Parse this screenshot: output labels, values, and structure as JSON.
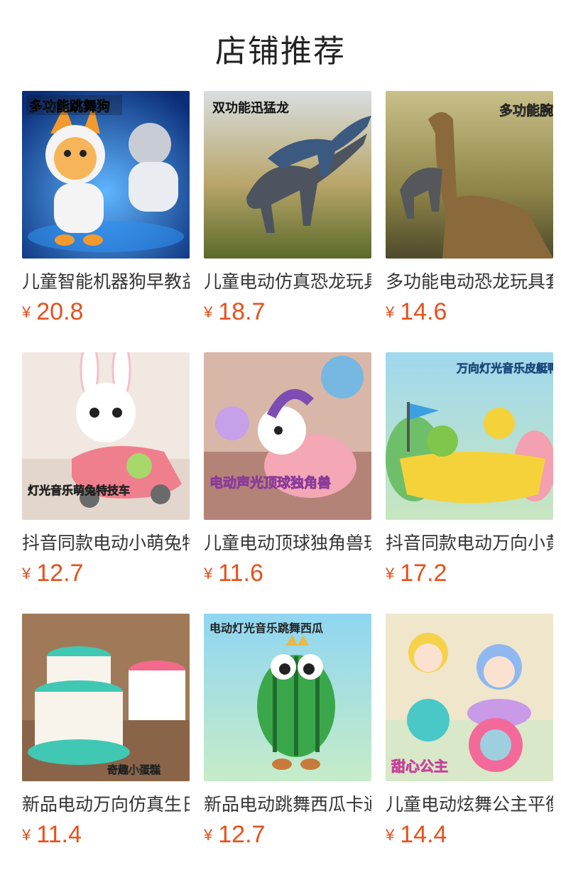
{
  "section_title": "店铺推荐",
  "currency_symbol": "¥",
  "colors": {
    "price": "#e8501c",
    "title": "#222222"
  },
  "products": [
    {
      "name": "儿童智能机器狗早教益智",
      "price": "20.8",
      "overlay": "多功能跳舞狗",
      "bg": "#1e4fa8"
    },
    {
      "name": "儿童电动仿真恐龙玩具",
      "price": "18.7",
      "overlay": "双功能迅猛龙",
      "bg": "#7a8a4a"
    },
    {
      "name": "多功能电动恐龙玩具套装",
      "price": "14.6",
      "overlay": "多功能腕龙",
      "bg": "#8f8a55"
    },
    {
      "name": "抖音同款电动小萌兔特技车",
      "price": "12.7",
      "overlay": "灯光音乐萌兔特技车",
      "bg": "#f4ece6"
    },
    {
      "name": "儿童电动顶球独角兽玩具",
      "price": "11.6",
      "overlay": "电动声光顶球独角兽",
      "bg": "#c9a39a"
    },
    {
      "name": "抖音同款电动万向小黄鸭",
      "price": "17.2",
      "overlay": "万向灯光音乐皮艇鸭子系列",
      "bg": "#8fd0e6"
    },
    {
      "name": "新品电动万向仿真生日蛋糕",
      "price": "11.4",
      "overlay": "奇趣小蛋糕",
      "bg": "#9b6f4e"
    },
    {
      "name": "新品电动跳舞西瓜卡通玩具",
      "price": "12.7",
      "overlay": "电动灯光音乐跳舞西瓜",
      "bg": "#7fc4e8"
    },
    {
      "name": "儿童电动炫舞公主平衡车",
      "price": "14.4",
      "overlay": "甜心公主",
      "bg": "#e8e0c8"
    }
  ]
}
